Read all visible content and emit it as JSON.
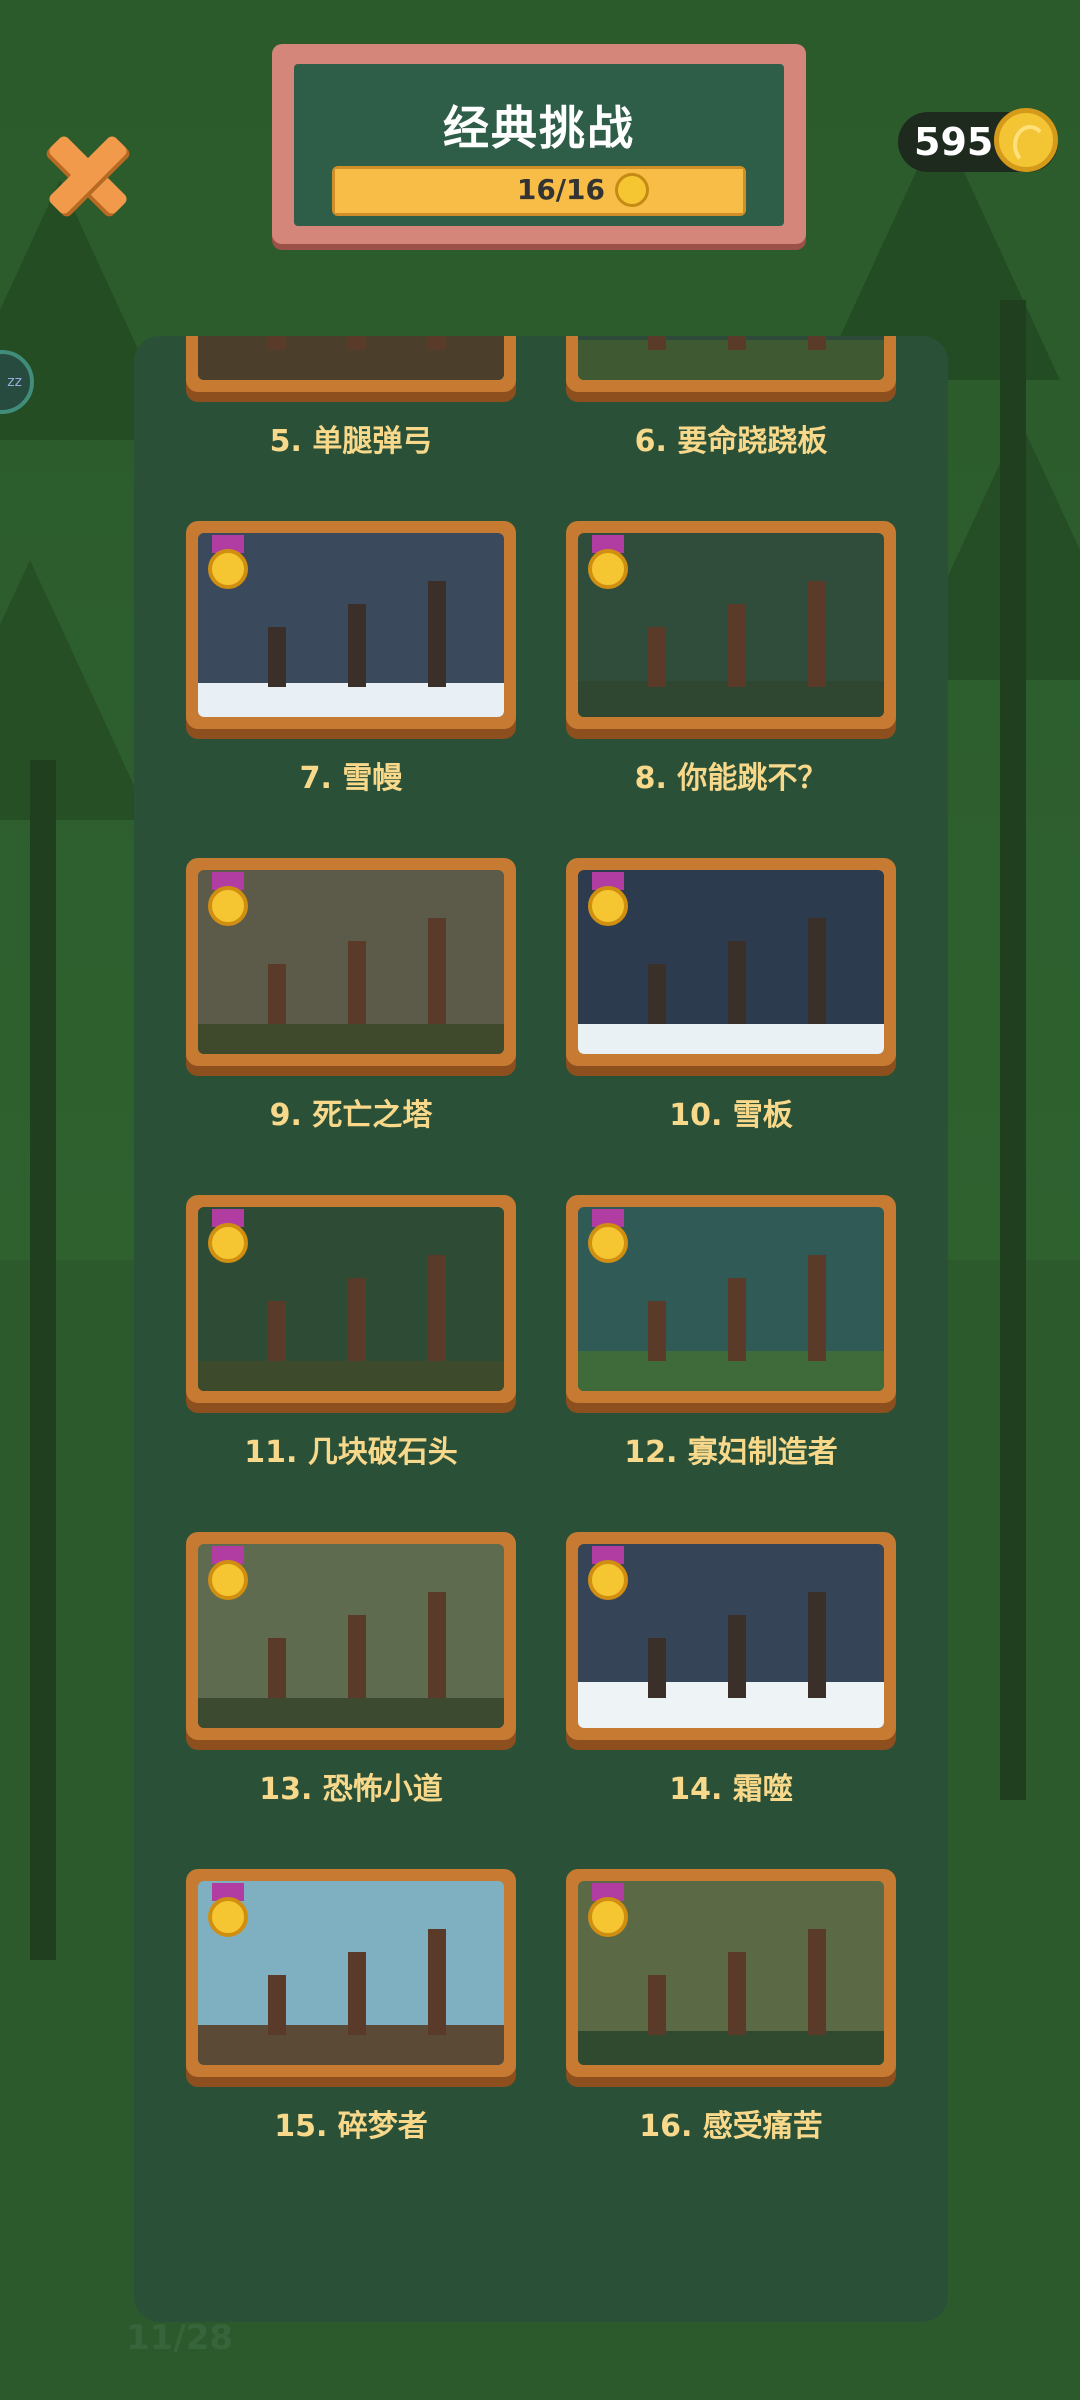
{
  "header": {
    "title": "经典挑战",
    "progress_text": "16/16",
    "progress_fraction": 1.0
  },
  "coins": {
    "value": "595"
  },
  "levels": [
    {
      "label": "5. 单腿弹弓",
      "scene": "forest-cliff",
      "medal": "gold"
    },
    {
      "label": "6. 要命跷跷板",
      "scene": "forest-pit",
      "medal": "gold"
    },
    {
      "label": "7. 雪幔",
      "scene": "snow-night",
      "medal": "gold"
    },
    {
      "label": "8. 你能跳不？",
      "scene": "forest-posts",
      "medal": "gold"
    },
    {
      "label": "9. 死亡之塔",
      "scene": "towers",
      "medal": "gold"
    },
    {
      "label": "10. 雪板",
      "scene": "snow-hill",
      "medal": "gold"
    },
    {
      "label": "11. 几块破石头",
      "scene": "rocks",
      "medal": "gold"
    },
    {
      "label": "12. 寡妇制造者",
      "scene": "pine-valley",
      "medal": "gold"
    },
    {
      "label": "13. 恐怖小道",
      "scene": "jungle",
      "medal": "gold"
    },
    {
      "label": "14. 霜噬",
      "scene": "snow-catapult",
      "medal": "gold"
    },
    {
      "label": "15. 碎梦者",
      "scene": "village-bridge",
      "medal": "gold"
    },
    {
      "label": "16. 感受痛苦",
      "scene": "jungle-tower",
      "medal": "gold"
    }
  ],
  "footer": {
    "page_count": "11/28"
  },
  "colors": {
    "accent": "#f7bd47",
    "label": "#f8d88a",
    "frame": "#c67a32",
    "medal": "#f6c632",
    "ribbon": "#b23da2"
  }
}
